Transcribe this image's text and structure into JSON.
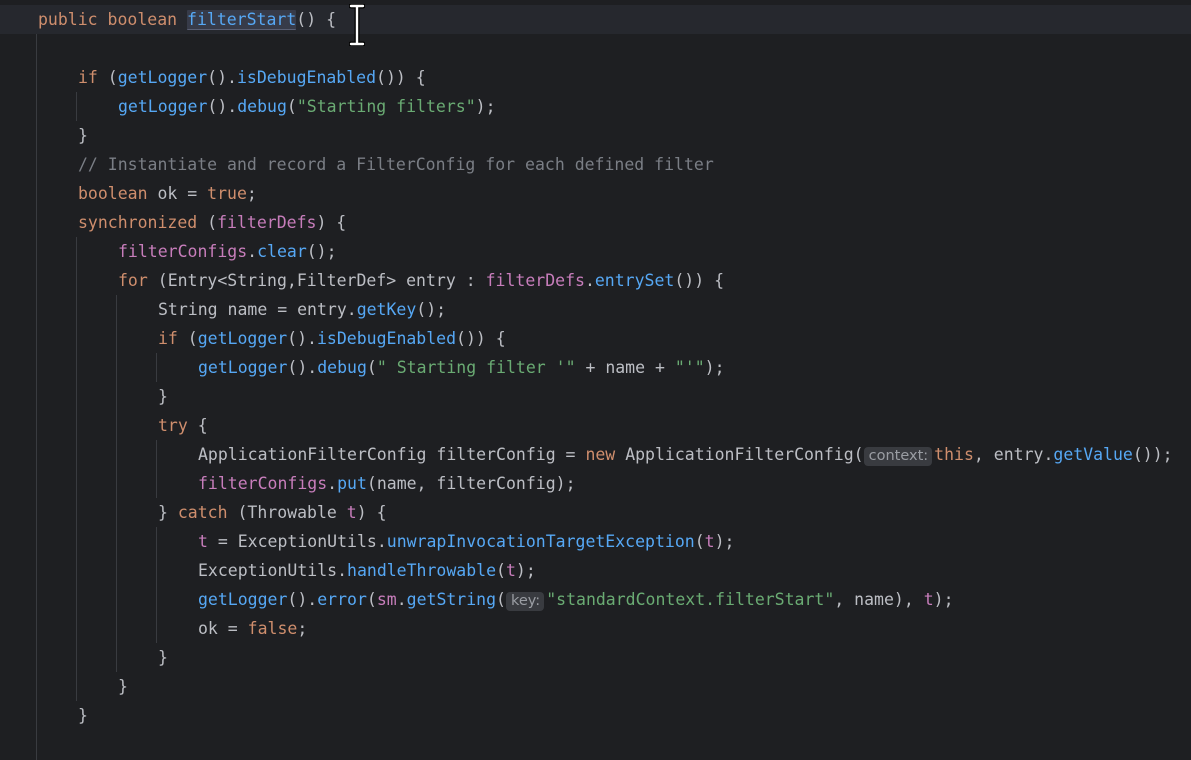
{
  "lines": [
    [
      {
        "t": "public boolean ",
        "c": "kw"
      },
      {
        "t": "filterStart",
        "c": "fn",
        "hl": true
      },
      {
        "t": "() {",
        "c": "punc"
      }
    ],
    [],
    [
      {
        "t": "if",
        "c": "kw"
      },
      {
        "t": " (",
        "c": "punc"
      },
      {
        "t": "getLogger",
        "c": "fn"
      },
      {
        "t": "().",
        "c": "punc"
      },
      {
        "t": "isDebugEnabled",
        "c": "fn"
      },
      {
        "t": "()) {",
        "c": "punc"
      }
    ],
    [
      {
        "t": "getLogger",
        "c": "fn"
      },
      {
        "t": "().",
        "c": "punc"
      },
      {
        "t": "debug",
        "c": "fn"
      },
      {
        "t": "(",
        "c": "punc"
      },
      {
        "t": "\"Starting filters\"",
        "c": "str"
      },
      {
        "t": ");",
        "c": "punc"
      }
    ],
    [
      {
        "t": "}",
        "c": "punc"
      }
    ],
    [
      {
        "t": "// Instantiate and record a FilterConfig for each defined filter",
        "c": "cmt"
      }
    ],
    [
      {
        "t": "boolean",
        "c": "kw"
      },
      {
        "t": " ok = ",
        "c": "punc"
      },
      {
        "t": "true",
        "c": "kw"
      },
      {
        "t": ";",
        "c": "punc"
      }
    ],
    [
      {
        "t": "synchronized",
        "c": "kw"
      },
      {
        "t": " (",
        "c": "punc"
      },
      {
        "t": "filterDefs",
        "c": "field"
      },
      {
        "t": ") {",
        "c": "punc"
      }
    ],
    [
      {
        "t": "filterConfigs",
        "c": "field"
      },
      {
        "t": ".",
        "c": "punc"
      },
      {
        "t": "clear",
        "c": "fn"
      },
      {
        "t": "();",
        "c": "punc"
      }
    ],
    [
      {
        "t": "for",
        "c": "kw"
      },
      {
        "t": " (",
        "c": "punc"
      },
      {
        "t": "Entry",
        "c": "cls"
      },
      {
        "t": "<",
        "c": "punc"
      },
      {
        "t": "String",
        "c": "cls"
      },
      {
        "t": ",",
        "c": "punc"
      },
      {
        "t": "FilterDef",
        "c": "cls"
      },
      {
        "t": "> entry : ",
        "c": "punc"
      },
      {
        "t": "filterDefs",
        "c": "field"
      },
      {
        "t": ".",
        "c": "punc"
      },
      {
        "t": "entrySet",
        "c": "fn"
      },
      {
        "t": "()) {",
        "c": "punc"
      }
    ],
    [
      {
        "t": "String",
        "c": "cls"
      },
      {
        "t": " name = entry.",
        "c": "punc"
      },
      {
        "t": "getKey",
        "c": "fn"
      },
      {
        "t": "();",
        "c": "punc"
      }
    ],
    [
      {
        "t": "if",
        "c": "kw"
      },
      {
        "t": " (",
        "c": "punc"
      },
      {
        "t": "getLogger",
        "c": "fn"
      },
      {
        "t": "().",
        "c": "punc"
      },
      {
        "t": "isDebugEnabled",
        "c": "fn"
      },
      {
        "t": "()) {",
        "c": "punc"
      }
    ],
    [
      {
        "t": "getLogger",
        "c": "fn"
      },
      {
        "t": "().",
        "c": "punc"
      },
      {
        "t": "debug",
        "c": "fn"
      },
      {
        "t": "(",
        "c": "punc"
      },
      {
        "t": "\" Starting filter '\"",
        "c": "str"
      },
      {
        "t": " + name + ",
        "c": "punc"
      },
      {
        "t": "\"'\"",
        "c": "str"
      },
      {
        "t": ");",
        "c": "punc"
      }
    ],
    [
      {
        "t": "}",
        "c": "punc"
      }
    ],
    [
      {
        "t": "try",
        "c": "kw"
      },
      {
        "t": " {",
        "c": "punc"
      }
    ],
    [
      {
        "t": "ApplicationFilterConfig",
        "c": "cls"
      },
      {
        "t": " filterConfig = ",
        "c": "punc"
      },
      {
        "t": "new",
        "c": "kw"
      },
      {
        "t": " ",
        "c": "punc"
      },
      {
        "t": "ApplicationFilterConfig",
        "c": "cls"
      },
      {
        "t": "(",
        "c": "punc"
      },
      {
        "t": "context:",
        "c": "hint"
      },
      {
        "t": "this",
        "c": "kw"
      },
      {
        "t": ", entry.",
        "c": "punc"
      },
      {
        "t": "getValue",
        "c": "fn"
      },
      {
        "t": "());",
        "c": "punc"
      }
    ],
    [
      {
        "t": "filterConfigs",
        "c": "field"
      },
      {
        "t": ".",
        "c": "punc"
      },
      {
        "t": "put",
        "c": "fn"
      },
      {
        "t": "(name, filterConfig);",
        "c": "punc"
      }
    ],
    [
      {
        "t": "} ",
        "c": "punc"
      },
      {
        "t": "catch",
        "c": "kw"
      },
      {
        "t": " (",
        "c": "punc"
      },
      {
        "t": "Throwable",
        "c": "cls"
      },
      {
        "t": " ",
        "c": "punc"
      },
      {
        "t": "t",
        "c": "field"
      },
      {
        "t": ") {",
        "c": "punc"
      }
    ],
    [
      {
        "t": "t",
        "c": "field"
      },
      {
        "t": " = ",
        "c": "punc"
      },
      {
        "t": "ExceptionUtils",
        "c": "cls"
      },
      {
        "t": ".",
        "c": "punc"
      },
      {
        "t": "unwrapInvocationTargetException",
        "c": "fn"
      },
      {
        "t": "(",
        "c": "punc"
      },
      {
        "t": "t",
        "c": "field"
      },
      {
        "t": ");",
        "c": "punc"
      }
    ],
    [
      {
        "t": "ExceptionUtils",
        "c": "cls"
      },
      {
        "t": ".",
        "c": "punc"
      },
      {
        "t": "handleThrowable",
        "c": "fn"
      },
      {
        "t": "(",
        "c": "punc"
      },
      {
        "t": "t",
        "c": "field"
      },
      {
        "t": ");",
        "c": "punc"
      }
    ],
    [
      {
        "t": "getLogger",
        "c": "fn"
      },
      {
        "t": "().",
        "c": "punc"
      },
      {
        "t": "error",
        "c": "fn"
      },
      {
        "t": "(",
        "c": "punc"
      },
      {
        "t": "sm",
        "c": "field"
      },
      {
        "t": ".",
        "c": "punc"
      },
      {
        "t": "getString",
        "c": "fn"
      },
      {
        "t": "(",
        "c": "punc"
      },
      {
        "t": "key:",
        "c": "hint"
      },
      {
        "t": "\"standardContext.filterStart\"",
        "c": "str"
      },
      {
        "t": ", name), ",
        "c": "punc"
      },
      {
        "t": "t",
        "c": "field"
      },
      {
        "t": ");",
        "c": "punc"
      }
    ],
    [
      {
        "t": "ok = ",
        "c": "punc"
      },
      {
        "t": "false",
        "c": "kw"
      },
      {
        "t": ";",
        "c": "punc"
      }
    ],
    [
      {
        "t": "}",
        "c": "punc"
      }
    ],
    [
      {
        "t": "}",
        "c": "punc"
      }
    ],
    [
      {
        "t": "}",
        "c": "punc"
      }
    ]
  ],
  "colors": {
    "background": "#1e1f22",
    "current_line": "#26282e",
    "keyword": "#cf8e6d",
    "method": "#56a8f5",
    "field": "#c77dbb",
    "string": "#6aab73",
    "comment": "#7a7e85",
    "text": "#bcbec4",
    "inlay_hint_bg": "#393b40",
    "inlay_hint_fg": "#9a9da3"
  },
  "cursor_icon": "text-cursor-ibeam-icon"
}
